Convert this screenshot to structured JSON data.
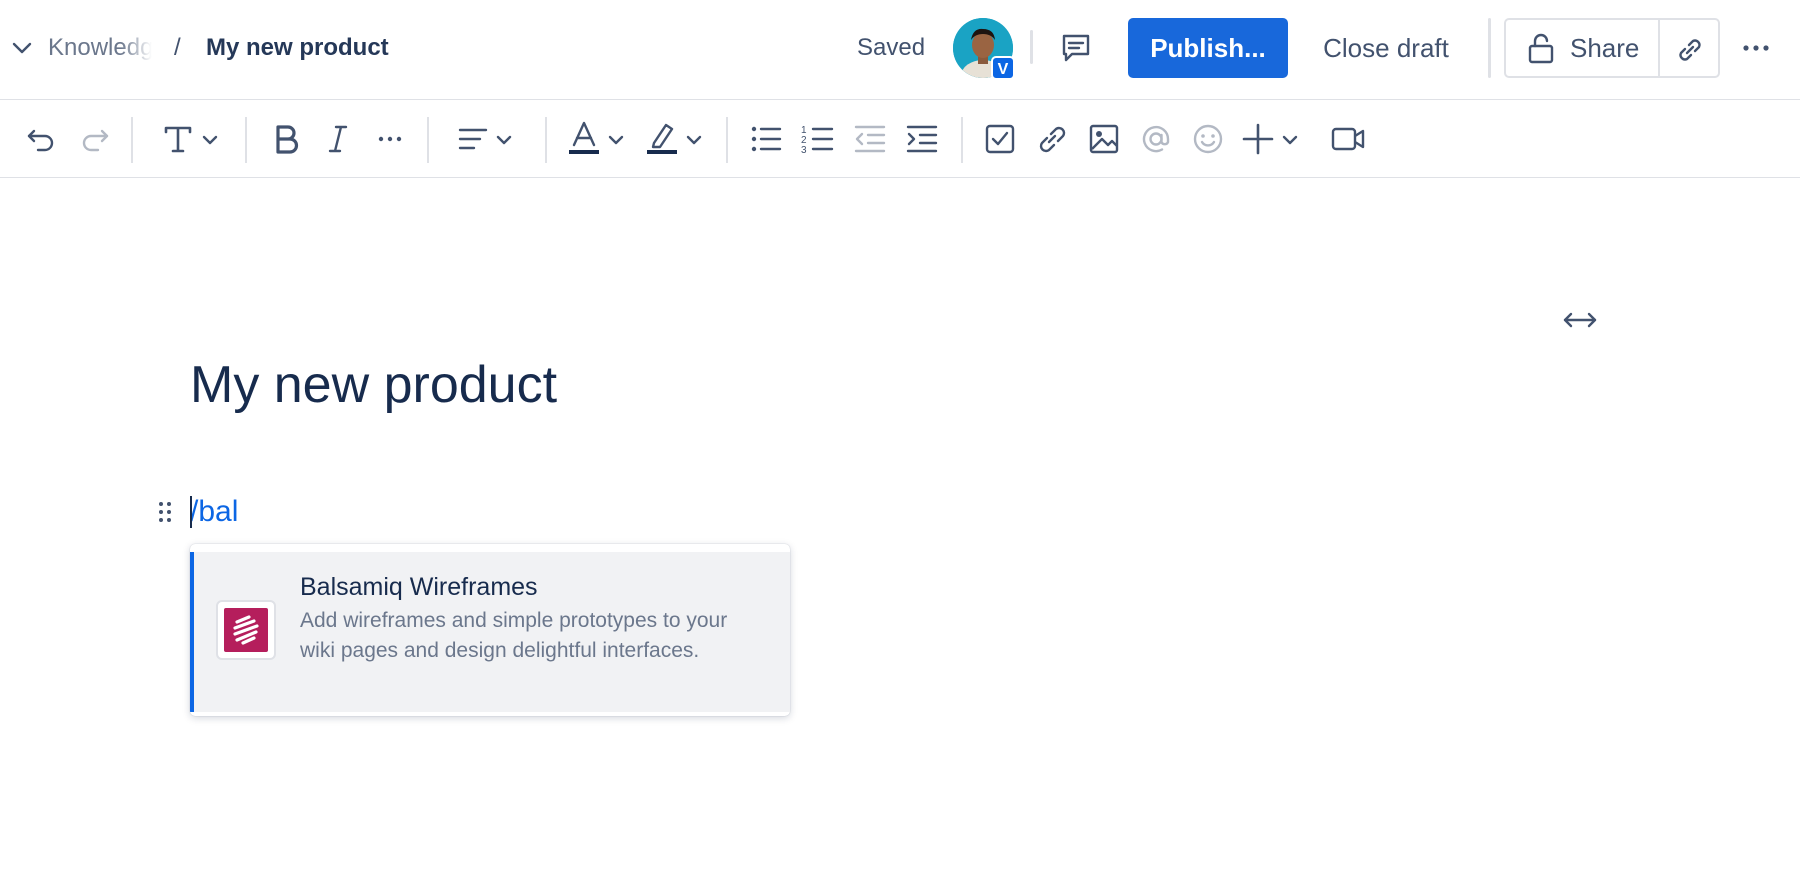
{
  "breadcrumb": {
    "space": "Knowledge",
    "separator": "/",
    "page_title": "My new product"
  },
  "header": {
    "status": "Saved",
    "avatar_initial": "V",
    "publish_label": "Publish...",
    "close_draft_label": "Close draft",
    "share_label": "Share"
  },
  "toolbar": {
    "icons": [
      "undo-icon",
      "redo-icon",
      "text-style-icon",
      "bold-icon",
      "italic-icon",
      "more-formatting-icon",
      "alignment-icon",
      "text-color-icon",
      "highlight-icon",
      "bullet-list-icon",
      "numbered-list-icon",
      "outdent-icon",
      "indent-icon",
      "action-item-icon",
      "link-icon",
      "image-icon",
      "mention-icon",
      "emoji-icon",
      "insert-icon",
      "video-icon"
    ]
  },
  "editor": {
    "title": "My new product",
    "typed_text": "/bal"
  },
  "slash_menu": {
    "items": [
      {
        "title": "Balsamiq Wireframes",
        "description": "Add wireframes and simple prototypes to your wiki pages and design delightful interfaces.",
        "icon": "balsamiq-logo-icon"
      }
    ]
  },
  "colors": {
    "primary": "#1868db",
    "text": "#172b4d",
    "subtle_text": "#6b778c",
    "balsamiq_brand": "#b51e5c"
  }
}
